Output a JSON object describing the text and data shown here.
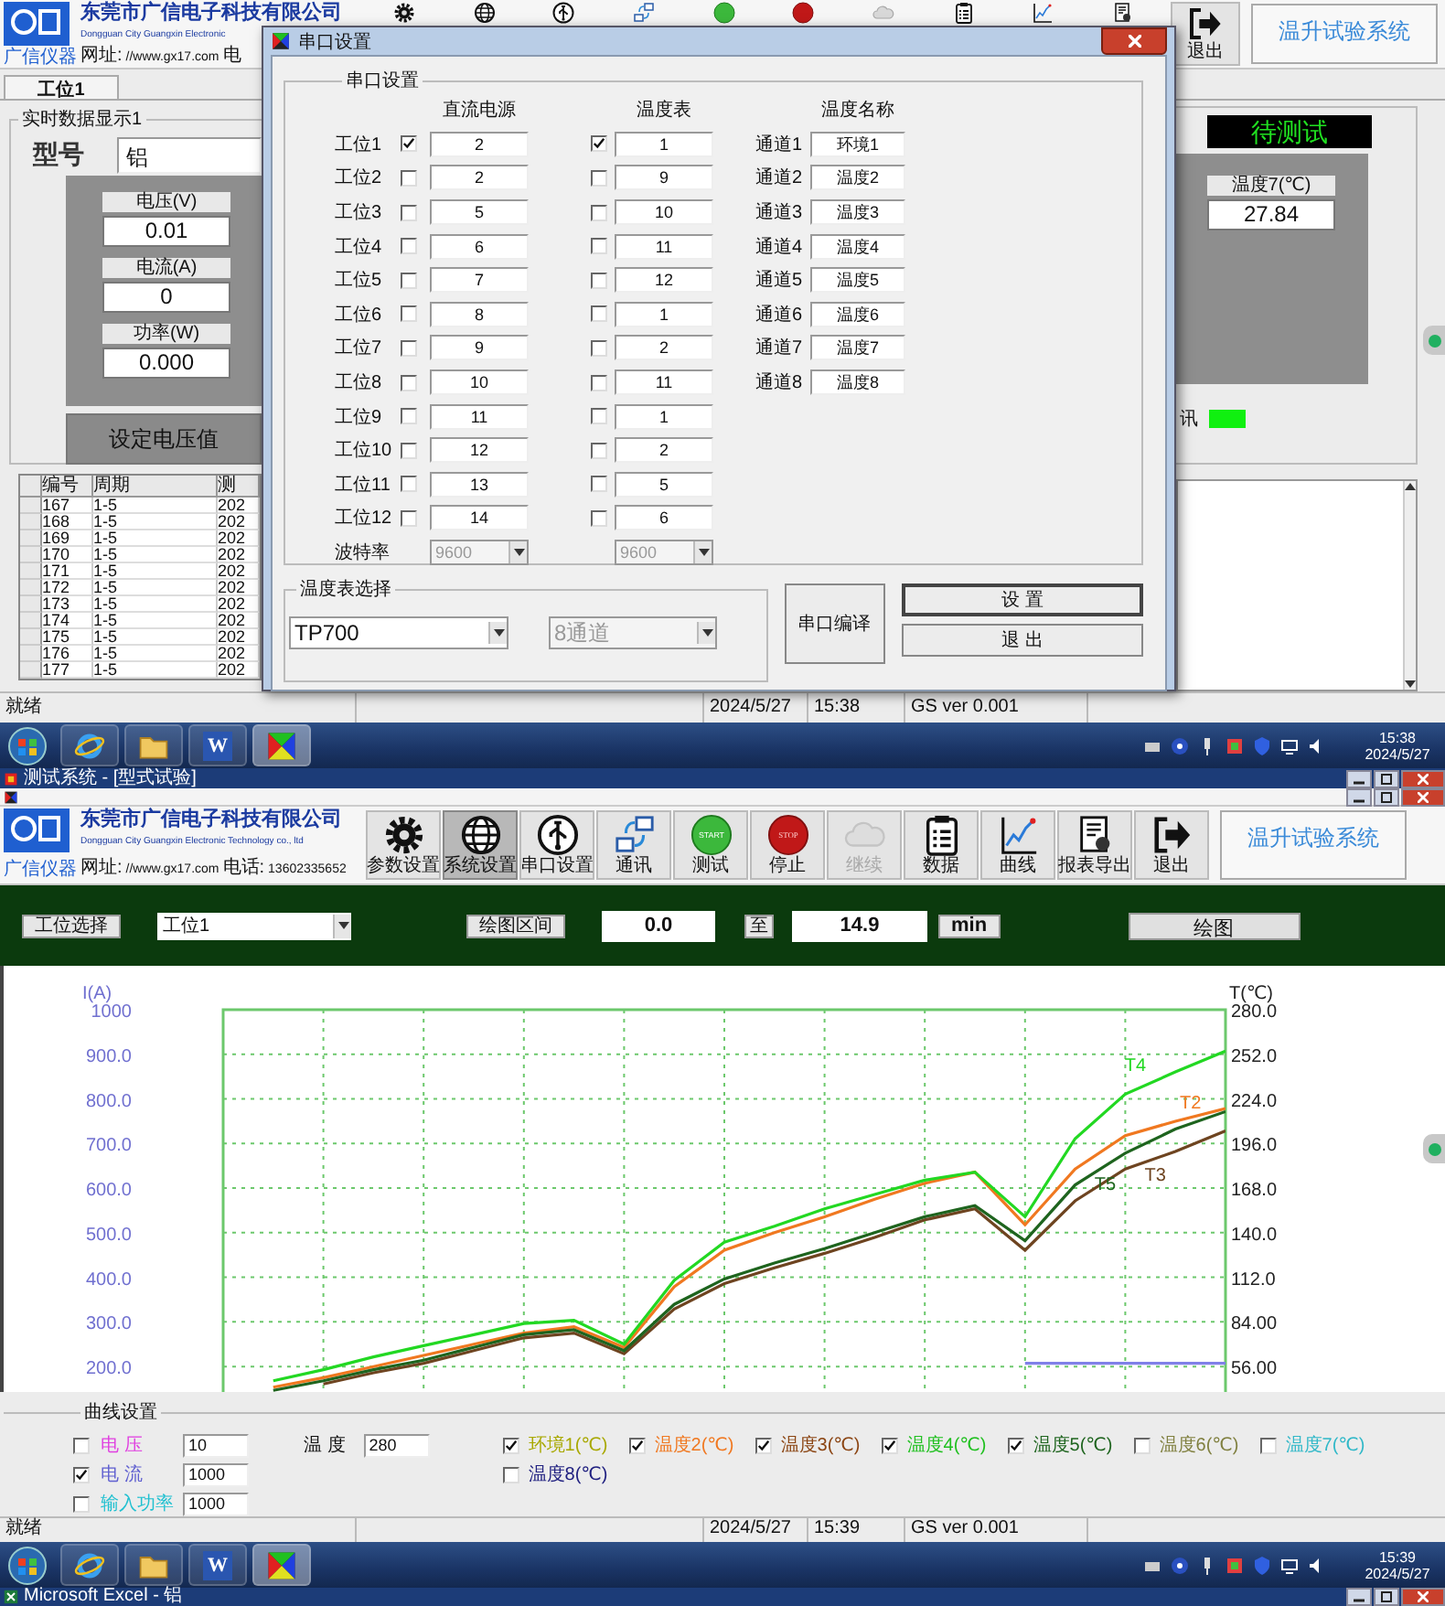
{
  "main_window": {
    "header": {
      "company": "东莞市广信电子科技有限公司",
      "company_en": "Dongguan City Guangxin Electronic",
      "logo_text": "广信仪器",
      "site_label": "网址:",
      "site": "//www.gx17.com",
      "phone_label": "电"
    },
    "toolbar": [
      {
        "kind": "gear"
      },
      {
        "kind": "globe"
      },
      {
        "kind": "usb"
      },
      {
        "kind": "network"
      },
      {
        "kind": "start"
      },
      {
        "kind": "stop"
      },
      {
        "kind": "cloud"
      },
      {
        "kind": "clipboard"
      },
      {
        "kind": "chart"
      },
      {
        "kind": "report"
      },
      {
        "kind": "exit",
        "label": "退出"
      }
    ],
    "system_title": "温升试验系统",
    "tabs": [
      {
        "label": "工位1",
        "selected": true
      }
    ],
    "group_title": "实时数据显示1",
    "model": {
      "label": "型号",
      "value": "铝"
    },
    "readings": [
      {
        "label": "电压(V)",
        "value": "0.01"
      },
      {
        "label": "电流(A)",
        "value": "0"
      },
      {
        "label": "功率(W)",
        "value": "0.000"
      }
    ],
    "set_voltage_button": "设定电压值",
    "table": {
      "columns": [
        "编号",
        "周期",
        "测"
      ],
      "rows": [
        [
          "167",
          "1-5",
          "202"
        ],
        [
          "168",
          "1-5",
          "202"
        ],
        [
          "169",
          "1-5",
          "202"
        ],
        [
          "170",
          "1-5",
          "202"
        ],
        [
          "171",
          "1-5",
          "202"
        ],
        [
          "172",
          "1-5",
          "202"
        ],
        [
          "173",
          "1-5",
          "202"
        ],
        [
          "174",
          "1-5",
          "202"
        ],
        [
          "175",
          "1-5",
          "202"
        ],
        [
          "176",
          "1-5",
          "202"
        ],
        [
          "177",
          "1-5",
          "202"
        ]
      ]
    },
    "test_state": "待测试",
    "temperature": {
      "label": "温度7(℃)",
      "value": "27.84"
    },
    "indicator": {
      "label": "讯",
      "on": true
    },
    "status_bar": {
      "state": "就绪",
      "date": "2024/5/27",
      "time": "15:38",
      "version": "GS ver 0.001"
    }
  },
  "dialog": {
    "title": "串口设置",
    "group_title": "串口设置",
    "columns": {
      "power": "直流电源",
      "meter": "温度表",
      "name": "温度名称"
    },
    "stations": [
      {
        "label": "工位1",
        "power_checked": true,
        "power_value": "2",
        "meter_checked": true,
        "meter_value": "1"
      },
      {
        "label": "工位2",
        "power_checked": false,
        "power_value": "2",
        "meter_checked": false,
        "meter_value": "9"
      },
      {
        "label": "工位3",
        "power_checked": false,
        "power_value": "5",
        "meter_checked": false,
        "meter_value": "10"
      },
      {
        "label": "工位4",
        "power_checked": false,
        "power_value": "6",
        "meter_checked": false,
        "meter_value": "11"
      },
      {
        "label": "工位5",
        "power_checked": false,
        "power_value": "7",
        "meter_checked": false,
        "meter_value": "12"
      },
      {
        "label": "工位6",
        "power_checked": false,
        "power_value": "8",
        "meter_checked": false,
        "meter_value": "1"
      },
      {
        "label": "工位7",
        "power_checked": false,
        "power_value": "9",
        "meter_checked": false,
        "meter_value": "2"
      },
      {
        "label": "工位8",
        "power_checked": false,
        "power_value": "10",
        "meter_checked": false,
        "meter_value": "11"
      },
      {
        "label": "工位9",
        "power_checked": false,
        "power_value": "11",
        "meter_checked": false,
        "meter_value": "1"
      },
      {
        "label": "工位10",
        "power_checked": false,
        "power_value": "12",
        "meter_checked": false,
        "meter_value": "2"
      },
      {
        "label": "工位11",
        "power_checked": false,
        "power_value": "13",
        "meter_checked": false,
        "meter_value": "5"
      },
      {
        "label": "工位12",
        "power_checked": false,
        "power_value": "14",
        "meter_checked": false,
        "meter_value": "6"
      }
    ],
    "channels": [
      {
        "label": "通道1",
        "name": "环境1"
      },
      {
        "label": "通道2",
        "name": "温度2"
      },
      {
        "label": "通道3",
        "name": "温度3"
      },
      {
        "label": "通道4",
        "name": "温度4"
      },
      {
        "label": "通道5",
        "name": "温度5"
      },
      {
        "label": "通道6",
        "name": "温度6"
      },
      {
        "label": "通道7",
        "name": "温度7"
      },
      {
        "label": "通道8",
        "name": "温度8"
      }
    ],
    "baud_label": "波特率",
    "power_baud": {
      "value": "9600",
      "disabled": true
    },
    "meter_baud": {
      "value": "9600",
      "disabled": true
    },
    "meter_group_title": "温度表选择",
    "meter_model": {
      "value": "TP700",
      "disabled": false
    },
    "channel_count": {
      "value": "8通道",
      "disabled": true
    },
    "compile_button": {
      "label": "串口编译",
      "default": false
    },
    "set_button": {
      "label": "设 置",
      "default": true
    },
    "exit_button": {
      "label": "退 出",
      "default": false
    }
  },
  "taskbar_top": {
    "apps": [
      {
        "kind": "ie",
        "active": false
      },
      {
        "kind": "folder",
        "active": false
      },
      {
        "kind": "word",
        "text": "W",
        "active": false
      },
      {
        "kind": "app",
        "active": true
      }
    ],
    "time": "15:38",
    "date": "2024/5/27"
  },
  "chart_window": {
    "title": "测试系统 - [型式试验]",
    "header": {
      "company": "东莞市广信电子科技有限公司",
      "company_en": "Dongguan City Guangxin Electronic Technology co., ltd",
      "logo_text": "广信仪器",
      "site_label": "网址:",
      "site": "//www.gx17.com",
      "phone_label": "电话:",
      "phone": "13602335652"
    },
    "toolbar": [
      {
        "kind": "gear",
        "label": "参数设置",
        "pressed": false,
        "disabled": false
      },
      {
        "kind": "globe",
        "label": "系统设置",
        "pressed": true,
        "disabled": false
      },
      {
        "kind": "usb",
        "label": "串口设置",
        "pressed": false,
        "disabled": false
      },
      {
        "kind": "network",
        "label": "通讯",
        "pressed": false,
        "disabled": false
      },
      {
        "kind": "start",
        "label": "测试",
        "icon_text": "START",
        "pressed": false,
        "disabled": false
      },
      {
        "kind": "stop",
        "label": "停止",
        "icon_text": "STOP",
        "pressed": false,
        "disabled": false
      },
      {
        "kind": "cloud",
        "label": "继续",
        "pressed": false,
        "disabled": true
      },
      {
        "kind": "clipboard",
        "label": "数据",
        "pressed": false,
        "disabled": false
      },
      {
        "kind": "chart",
        "label": "曲线",
        "pressed": false,
        "disabled": false
      },
      {
        "kind": "report",
        "label": "报表导出",
        "pressed": false,
        "disabled": false
      },
      {
        "kind": "exit",
        "label": "退出",
        "pressed": false,
        "disabled": false
      }
    ],
    "system_title": "温升试验系统",
    "controls": {
      "station_label": "工位选择",
      "station_value": "工位1",
      "range_label": "绘图区间",
      "range_from": "0.0",
      "to_label": "至",
      "range_to": "14.9",
      "unit": "min",
      "plot_button": "绘图"
    },
    "current_axis": {
      "title": "I(A)",
      "ticks": [
        "1000",
        "900.0",
        "800.0",
        "700.0",
        "600.0",
        "500.0",
        "400.0",
        "300.0",
        "200.0"
      ]
    },
    "chart_data": {
      "type": "line",
      "ylabel": "T(℃)",
      "grid": true,
      "categories": [
        null,
        null,
        null,
        null,
        null,
        null,
        null,
        null,
        null,
        null,
        null,
        null,
        null,
        null,
        null,
        null,
        null,
        null,
        null,
        null,
        null
      ],
      "ylim": [
        40,
        280
      ],
      "yticks": [
        {
          "value": 280,
          "label": "280.0"
        },
        {
          "value": 252,
          "label": "252.0"
        },
        {
          "value": 224,
          "label": "224.0"
        },
        {
          "value": 196,
          "label": "196.0"
        },
        {
          "value": 168,
          "label": "168.0"
        },
        {
          "value": 140,
          "label": "140.0"
        },
        {
          "value": 112,
          "label": "112.0"
        },
        {
          "value": 84,
          "label": "84.00"
        },
        {
          "value": 56,
          "label": "56.00"
        }
      ],
      "series": [
        {
          "name": "T2",
          "color": "#f07820",
          "values": [
            null,
            43,
            49,
            56,
            63,
            70,
            77,
            81,
            68,
            106,
            129,
            140,
            150,
            161,
            171,
            178,
            145,
            180,
            201,
            210,
            218
          ]
        },
        {
          "name": "T3",
          "color": "#6e4420",
          "values": [
            null,
            null,
            45,
            52,
            58,
            66,
            74,
            77,
            64,
            92,
            108,
            118,
            127,
            137,
            148,
            155,
            129,
            160,
            180,
            191,
            204
          ]
        },
        {
          "name": "T4",
          "color": "#22d822",
          "values": [
            null,
            47,
            54,
            62,
            69,
            76,
            83,
            85,
            70,
            110,
            134,
            144,
            155,
            164,
            173,
            178,
            150,
            199,
            227,
            241,
            254
          ]
        },
        {
          "name": "T5",
          "color": "#1e641e",
          "values": [
            null,
            41,
            47,
            54,
            60,
            68,
            76,
            79,
            66,
            95,
            111,
            121,
            130,
            140,
            150,
            157,
            135,
            170,
            190,
            205,
            216
          ]
        },
        {
          "color": "#8080e8",
          "values": [
            null,
            null,
            null,
            null,
            null,
            null,
            null,
            null,
            null,
            null,
            null,
            null,
            null,
            null,
            null,
            null,
            58,
            58,
            58,
            58,
            58
          ]
        }
      ]
    },
    "curve_settings": {
      "title": "曲线设置",
      "electric": [
        {
          "label": "电 压",
          "checked": false,
          "value": "10",
          "color": "#e040e0"
        },
        {
          "label": "电 流",
          "checked": true,
          "value": "1000",
          "color": "#6060d0"
        },
        {
          "label": "输入功率",
          "checked": false,
          "value": "1000",
          "color": "#20c0d0"
        }
      ],
      "temp_label": "温 度",
      "temp_value": "280",
      "channels": [
        {
          "label": "环境1(℃)",
          "checked": true,
          "color": "#a8a800"
        },
        {
          "label": "温度2(℃)",
          "checked": true,
          "color": "#f07820"
        },
        {
          "label": "温度3(℃)",
          "checked": true,
          "color": "#8b4513"
        },
        {
          "label": "温度4(℃)",
          "checked": true,
          "color": "#20c020"
        },
        {
          "label": "温度5(℃)",
          "checked": true,
          "color": "#1e641e"
        },
        {
          "label": "温度6(℃)",
          "checked": false,
          "color": "#808040"
        },
        {
          "label": "温度7(℃)",
          "checked": false,
          "color": "#30b8c8"
        },
        {
          "label": "温度8(℃)",
          "checked": false,
          "color": "#202080"
        }
      ]
    },
    "status_bar": {
      "state": "就绪",
      "date": "2024/5/27",
      "time": "15:39",
      "version": "GS ver 0.001"
    }
  },
  "taskbar_bottom": {
    "apps": [
      {
        "kind": "ie",
        "active": false
      },
      {
        "kind": "folder",
        "active": false
      },
      {
        "kind": "word",
        "text": "W",
        "active": false
      },
      {
        "kind": "app",
        "active": true
      }
    ],
    "time": "15:39",
    "date": "2024/5/27"
  },
  "excel_bar": {
    "title": "Microsoft Excel - 铝"
  }
}
